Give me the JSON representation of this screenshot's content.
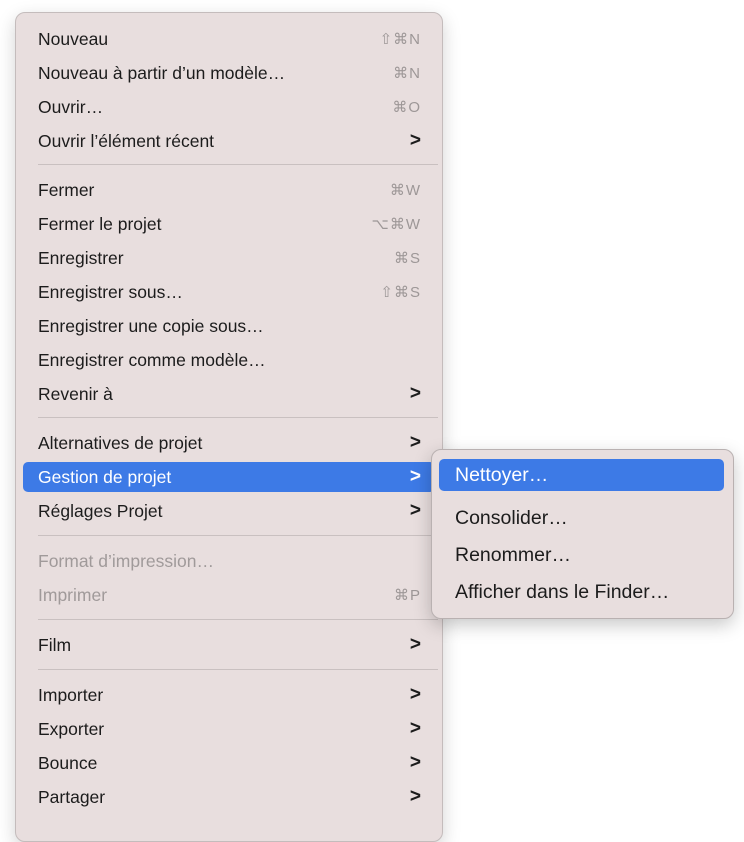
{
  "menu": {
    "items": [
      {
        "label": "Nouveau",
        "shortcut": "⇧⌘N"
      },
      {
        "label": "Nouveau à partir d’un modèle…",
        "shortcut": "⌘N"
      },
      {
        "label": "Ouvrir…",
        "shortcut": "⌘O"
      },
      {
        "label": "Ouvrir l’élément récent",
        "submenu_glyph": ">"
      },
      {
        "label": "Fermer",
        "shortcut": "⌘W"
      },
      {
        "label": "Fermer le projet",
        "shortcut": "⌥⌘W"
      },
      {
        "label": "Enregistrer",
        "shortcut": "⌘S"
      },
      {
        "label": "Enregistrer sous…",
        "shortcut": "⇧⌘S"
      },
      {
        "label": "Enregistrer une copie sous…"
      },
      {
        "label": "Enregistrer comme modèle…"
      },
      {
        "label": "Revenir à",
        "submenu_glyph": ">"
      },
      {
        "label": "Alternatives de projet",
        "submenu_glyph": ">"
      },
      {
        "label": "Gestion de projet",
        "submenu_glyph": ">",
        "state": "highlighted"
      },
      {
        "label": "Réglages Projet",
        "submenu_glyph": ">"
      },
      {
        "label": "Format d’impression…",
        "state": "disabled"
      },
      {
        "label": "Imprimer",
        "shortcut": "⌘P",
        "state": "disabled"
      },
      {
        "label": "Film",
        "submenu_glyph": ">"
      },
      {
        "label": "Importer",
        "submenu_glyph": ">"
      },
      {
        "label": "Exporter",
        "submenu_glyph": ">"
      },
      {
        "label": "Bounce",
        "submenu_glyph": ">"
      },
      {
        "label": "Partager",
        "submenu_glyph": ">"
      }
    ]
  },
  "submenu": {
    "items": [
      {
        "label": "Nettoyer…",
        "state": "highlighted"
      },
      {
        "label": "Consolider…"
      },
      {
        "label": "Renommer…"
      },
      {
        "label": "Afficher dans le Finder…"
      }
    ]
  },
  "colors": {
    "menu_background": "#e8dede",
    "highlight": "#3d7ae6",
    "text": "#1c1c1c",
    "disabled_text": "#a09a9a",
    "shortcut_text": "#9d9797"
  }
}
